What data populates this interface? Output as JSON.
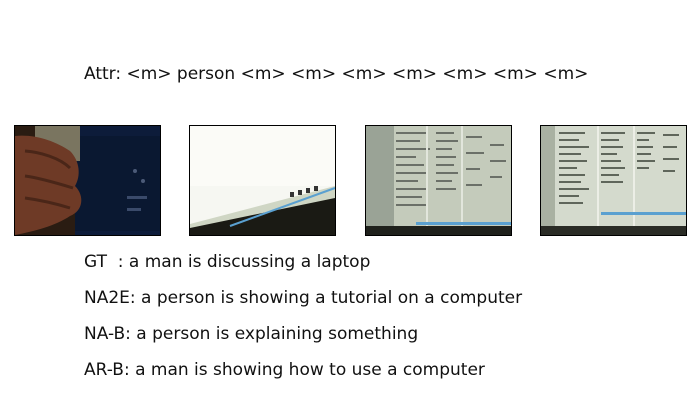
{
  "attr_line": "Attr: <m> person <m> <m> <m> <m> <m> <m> <m>",
  "frames": [
    {
      "icon": "hand-near-laptop-frame"
    },
    {
      "icon": "bright-screen-frame"
    },
    {
      "icon": "spreadsheet-screen-frame"
    },
    {
      "icon": "spreadsheet-screen-closeup-frame"
    }
  ],
  "captions": {
    "gt": "GT  : a man is discussing a laptop",
    "na2e": "NA2E: a person is showing a tutorial on a computer",
    "nab": "NA-B: a person is explaining something",
    "arb": "AR-B: a man is showing how to use a computer"
  }
}
